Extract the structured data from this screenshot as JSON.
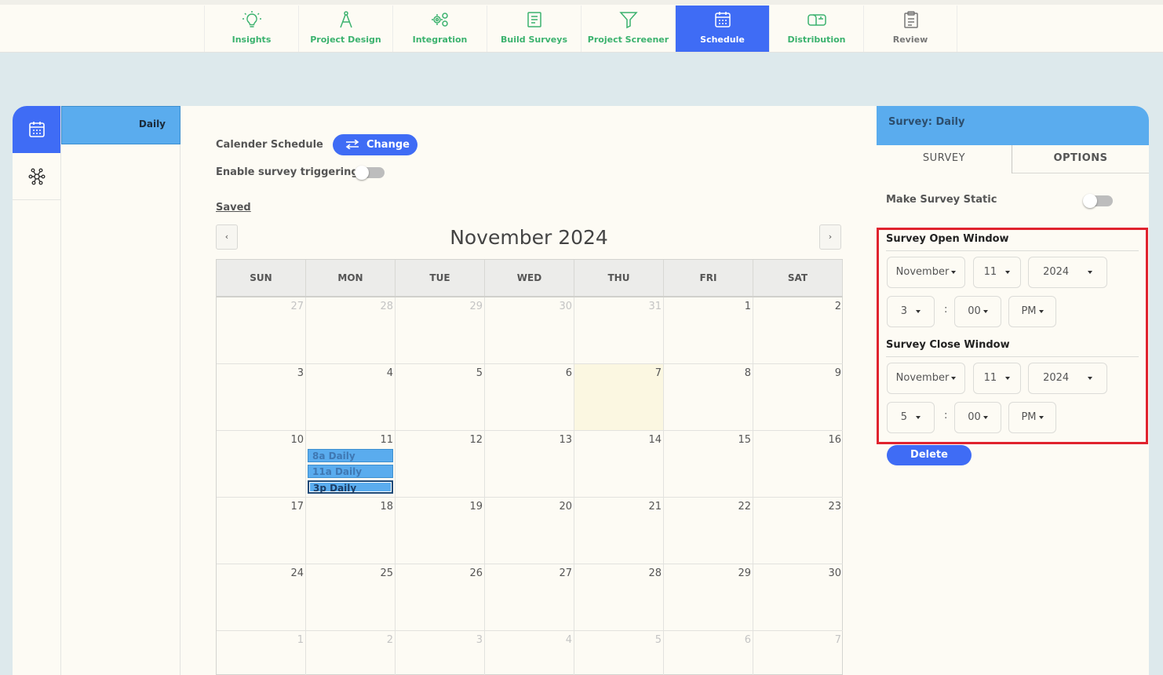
{
  "nav": {
    "items": [
      {
        "label": "Insights",
        "icon": "lightbulb-icon"
      },
      {
        "label": "Project Design",
        "icon": "compass-icon"
      },
      {
        "label": "Integration",
        "icon": "gears-icon"
      },
      {
        "label": "Build Surveys",
        "icon": "form-icon"
      },
      {
        "label": "Project Screener",
        "icon": "filter-icon"
      },
      {
        "label": "Schedule",
        "icon": "calendar-icon"
      },
      {
        "label": "Distribution",
        "icon": "mailbox-icon"
      },
      {
        "label": "Review",
        "icon": "clipboard-icon"
      }
    ],
    "active": "Schedule"
  },
  "sidebar": {
    "survey_item": "Daily"
  },
  "main": {
    "calendar_schedule_label": "Calender Schedule",
    "change_label": "Change",
    "enable_trigger_label": "Enable survey triggering",
    "saved_label": "Saved",
    "prev_label": "‹",
    "next_label": "›"
  },
  "calendar": {
    "title": "November 2024",
    "weekdays": [
      "SUN",
      "MON",
      "TUE",
      "WED",
      "THU",
      "FRI",
      "SAT"
    ],
    "weeks": [
      [
        [
          "27",
          1
        ],
        [
          "28",
          1
        ],
        [
          "29",
          1
        ],
        [
          "30",
          1
        ],
        [
          "31",
          1
        ],
        [
          "1",
          0
        ],
        [
          "2",
          0
        ]
      ],
      [
        [
          "3",
          0
        ],
        [
          "4",
          0
        ],
        [
          "5",
          0
        ],
        [
          "6",
          0
        ],
        [
          "7",
          0
        ],
        [
          "8",
          0
        ],
        [
          "9",
          0
        ]
      ],
      [
        [
          "10",
          0
        ],
        [
          "11",
          0
        ],
        [
          "12",
          0
        ],
        [
          "13",
          0
        ],
        [
          "14",
          0
        ],
        [
          "15",
          0
        ],
        [
          "16",
          0
        ]
      ],
      [
        [
          "17",
          0
        ],
        [
          "18",
          0
        ],
        [
          "19",
          0
        ],
        [
          "20",
          0
        ],
        [
          "21",
          0
        ],
        [
          "22",
          0
        ],
        [
          "23",
          0
        ]
      ],
      [
        [
          "24",
          0
        ],
        [
          "25",
          0
        ],
        [
          "26",
          0
        ],
        [
          "27",
          0
        ],
        [
          "28",
          0
        ],
        [
          "29",
          0
        ],
        [
          "30",
          0
        ]
      ],
      [
        [
          "1",
          1
        ],
        [
          "2",
          1
        ],
        [
          "3",
          1
        ],
        [
          "4",
          1
        ],
        [
          "5",
          1
        ],
        [
          "6",
          1
        ],
        [
          "7",
          1
        ]
      ]
    ],
    "today": "7",
    "events": [
      {
        "day": "11",
        "label": "8a Daily",
        "selected": false
      },
      {
        "day": "11",
        "label": "11a Daily",
        "selected": false
      },
      {
        "day": "11",
        "label": "3p Daily",
        "selected": true
      }
    ]
  },
  "panel": {
    "header": "Survey: Daily",
    "tab_survey": "SURVEY",
    "tab_options": "OPTIONS",
    "static_label": "Make Survey Static",
    "open_title": "Survey Open Window",
    "open": {
      "month": "November",
      "day": "11",
      "year": "2024",
      "hour": "3",
      "minute": "00",
      "ampm": "PM"
    },
    "close_title": "Survey Close Window",
    "close": {
      "month": "November",
      "day": "11",
      "year": "2024",
      "hour": "5",
      "minute": "00",
      "ampm": "PM"
    },
    "colon": ":",
    "delete_label": "Delete"
  },
  "colors": {
    "accent": "#3f6cf5",
    "nav_green": "#3bb26e",
    "event_blue": "#5aacee",
    "highlight_red": "#e0232e"
  }
}
